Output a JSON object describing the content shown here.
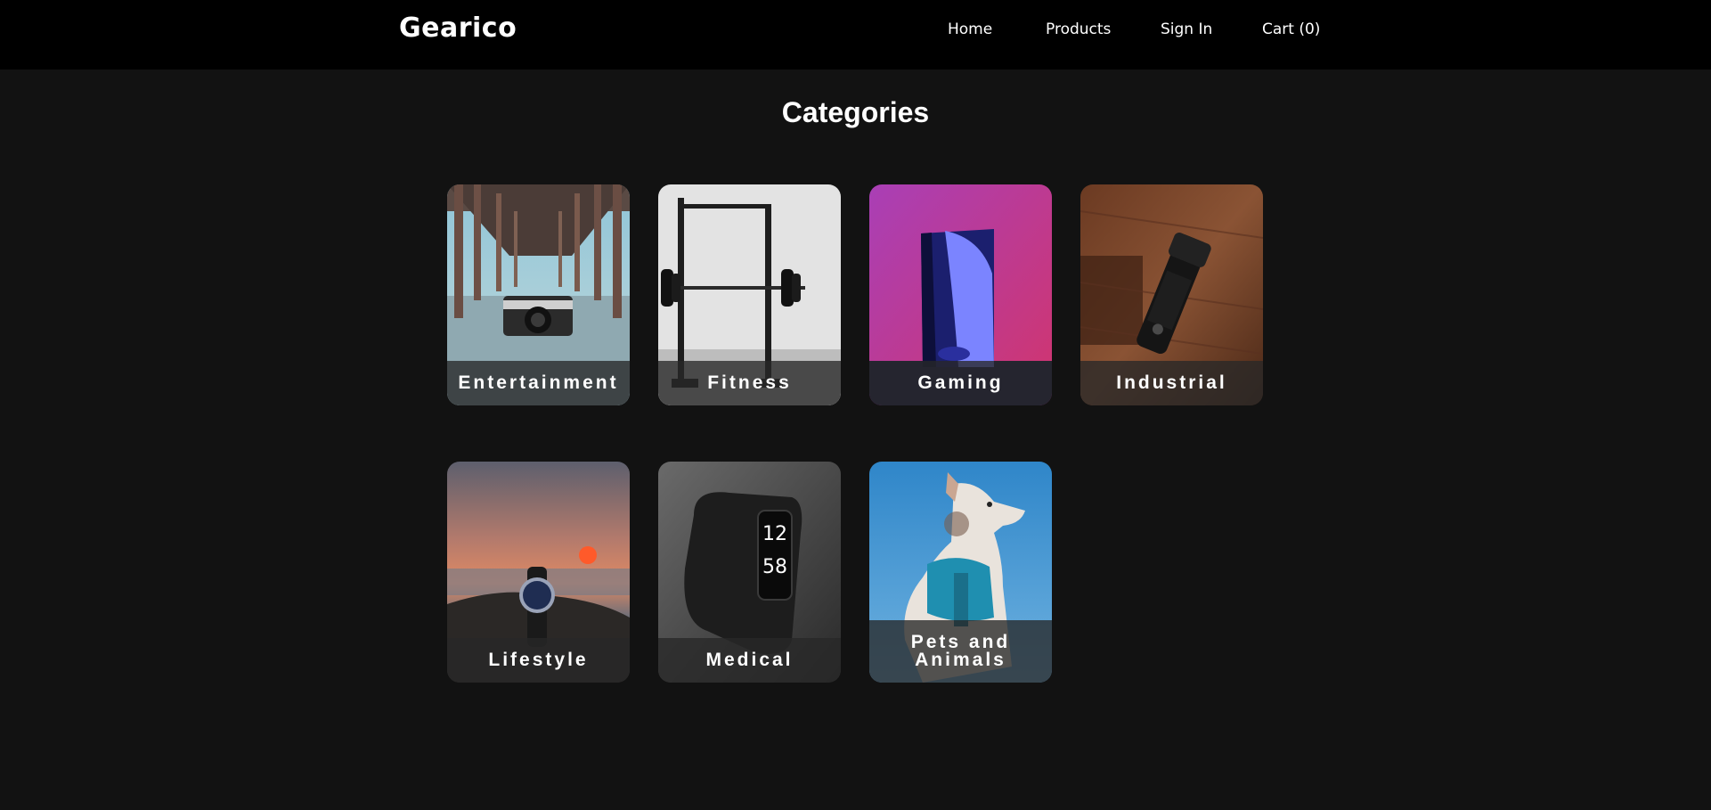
{
  "brand": "Gearico",
  "nav": {
    "home": "Home",
    "products": "Products",
    "sign_in": "Sign In",
    "cart": "Cart (0)"
  },
  "page_title": "Categories",
  "categories": [
    {
      "label": "Entertainment",
      "image": "camera-under-pier"
    },
    {
      "label": "Fitness",
      "image": "squat-rack-barbell"
    },
    {
      "label": "Gaming",
      "image": "game-console"
    },
    {
      "label": "Industrial",
      "image": "flashlight-on-wood"
    },
    {
      "label": "Lifestyle",
      "image": "wristwatch-at-sunset"
    },
    {
      "label": "Medical",
      "image": "fitness-tracker"
    },
    {
      "label": "Pets and Animals",
      "image": "dog-in-harness"
    }
  ],
  "colors": {
    "navbar": "#000000",
    "background": "#121212",
    "text": "#ffffff"
  }
}
